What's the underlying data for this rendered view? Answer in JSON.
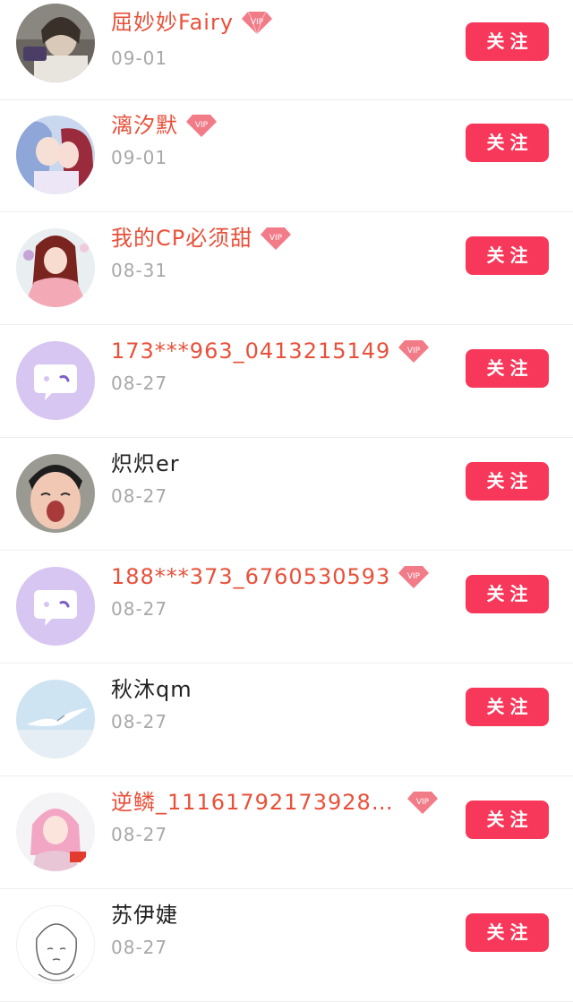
{
  "colors": {
    "vip_name": "#e8503a",
    "plain_name": "#222222",
    "date": "#a8a8a8",
    "follow_button": "#f7385a",
    "vip_badge": "#f27b88"
  },
  "follow_label": "关注",
  "vip_badge_text": "VIP",
  "users": [
    {
      "name": "屈妙妙Fairy",
      "date": "09-01",
      "vip": true,
      "avatar": "photo-girl-icon"
    },
    {
      "name": "漓汐默",
      "date": "09-01",
      "vip": true,
      "avatar": "anime-couple-icon"
    },
    {
      "name": "我的CP必须甜",
      "date": "08-31",
      "vip": true,
      "avatar": "anime-girl-icon"
    },
    {
      "name": "173***963_0413215149",
      "date": "08-27",
      "vip": true,
      "avatar": "default-chat-icon"
    },
    {
      "name": "炽炽er",
      "date": "08-27",
      "vip": false,
      "avatar": "photo-crying-boy-icon"
    },
    {
      "name": "188***373_6760530593",
      "date": "08-27",
      "vip": true,
      "avatar": "default-chat-icon"
    },
    {
      "name": "秋沐qm",
      "date": "08-27",
      "vip": false,
      "avatar": "bird-sky-icon"
    },
    {
      "name": "逆鳞_11161792173928…",
      "date": "08-27",
      "vip": true,
      "avatar": "pink-hair-girl-icon"
    },
    {
      "name": "苏伊婕",
      "date": "08-27",
      "vip": false,
      "avatar": "sketch-face-icon"
    }
  ]
}
